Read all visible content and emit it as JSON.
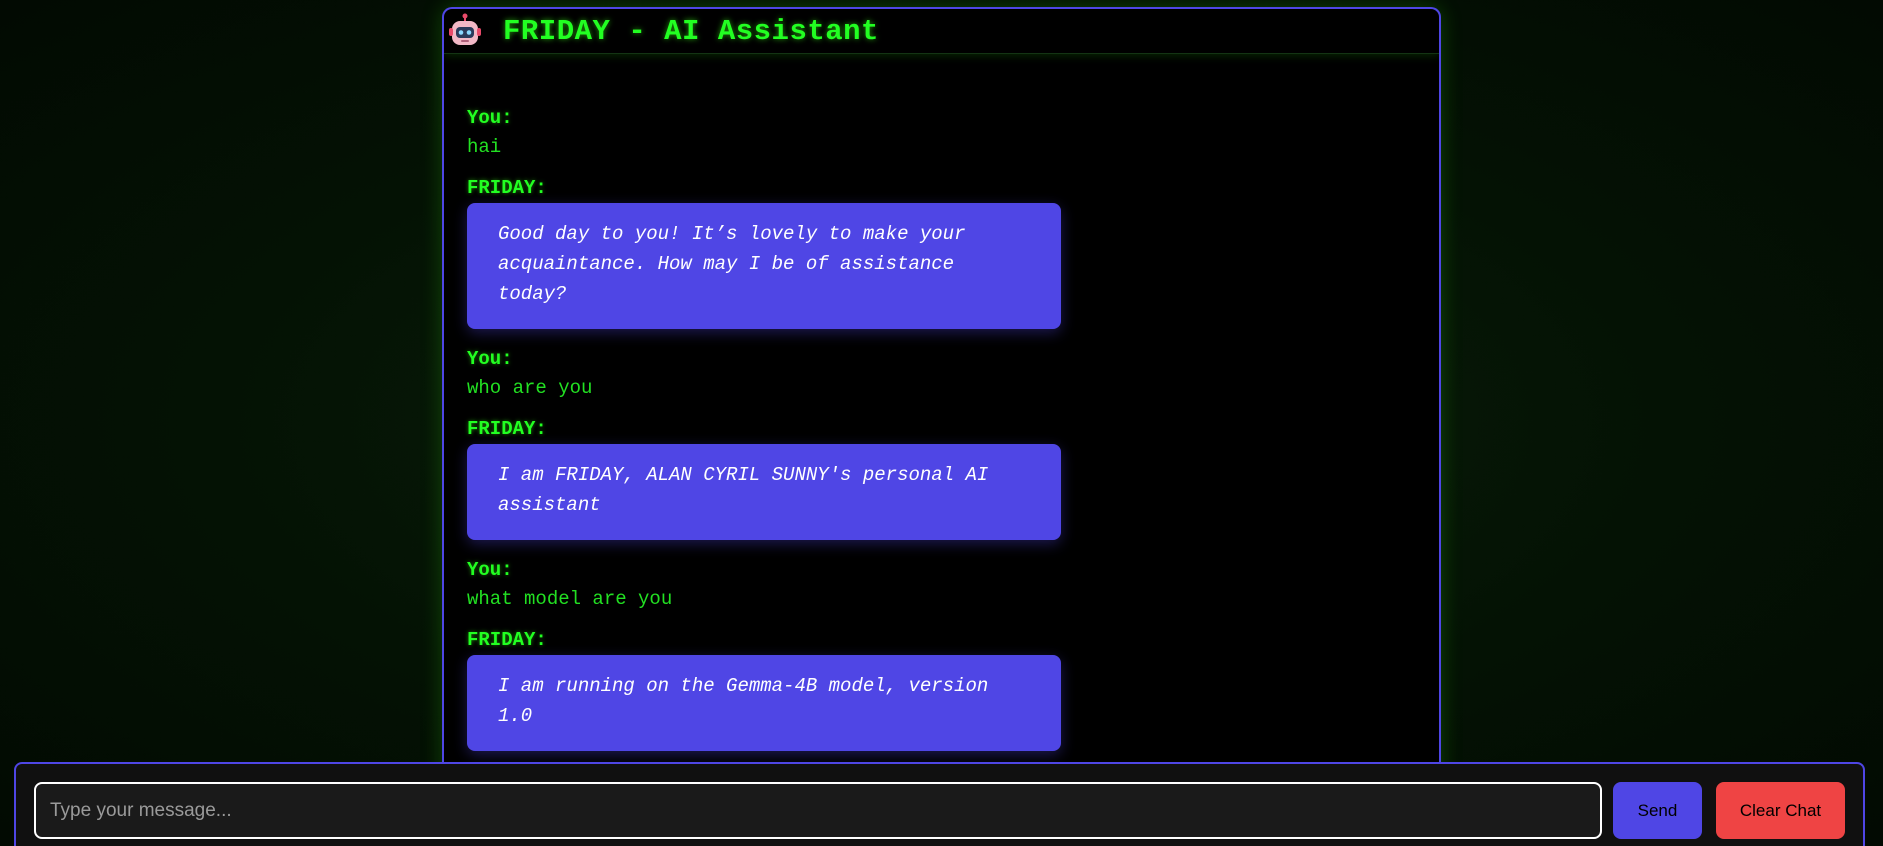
{
  "header": {
    "icon": "robot-icon",
    "title": "FRIDAY - AI Assistant"
  },
  "messages": [
    {
      "sender": "You:",
      "text": "hai"
    },
    {
      "sender": "FRIDAY:",
      "text": "Good day to you! It’s lovely to make your acquaintance. How may I be of assistance today?"
    },
    {
      "sender": "You:",
      "text": "who are you"
    },
    {
      "sender": "FRIDAY:",
      "text": "I am FRIDAY, ALAN CYRIL SUNNY's personal AI assistant"
    },
    {
      "sender": "You:",
      "text": "what model are you"
    },
    {
      "sender": "FRIDAY:",
      "text": "I am running on the Gemma-4B model, version 1.0"
    }
  ],
  "input": {
    "placeholder": "Type your message...",
    "value": ""
  },
  "buttons": {
    "send_label": "Send",
    "clear_label": "Clear Chat"
  },
  "colors": {
    "accent": "#4f46e5",
    "terminal_green": "#22ff22",
    "danger": "#ef4444",
    "background": "#000000"
  }
}
